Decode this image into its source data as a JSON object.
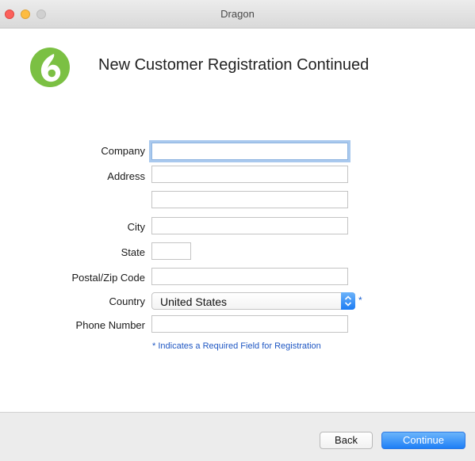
{
  "window": {
    "title": "Dragon"
  },
  "header": {
    "heading": "New Customer Registration Continued",
    "logo_icon": "dragon-logo-icon",
    "logo_color": "#7bc043"
  },
  "form": {
    "company": {
      "label": "Company",
      "value": "",
      "placeholder": ""
    },
    "address": {
      "label": "Address",
      "value": "",
      "placeholder": ""
    },
    "address2": {
      "value": "",
      "placeholder": ""
    },
    "city": {
      "label": "City",
      "value": "",
      "placeholder": ""
    },
    "state": {
      "label": "State",
      "value": "",
      "placeholder": ""
    },
    "postal": {
      "label": "Postal/Zip Code",
      "value": "",
      "placeholder": ""
    },
    "country": {
      "label": "Country",
      "value": "United States",
      "required_marker": "*"
    },
    "phone": {
      "label": "Phone Number",
      "value": "",
      "placeholder": ""
    },
    "required_note": "* Indicates a Required Field for Registration"
  },
  "footer": {
    "back_label": "Back",
    "continue_label": "Continue"
  },
  "colors": {
    "accent": "#1e7ff6",
    "focus_ring": "#a9c9ee",
    "required_text": "#1f57c3"
  }
}
